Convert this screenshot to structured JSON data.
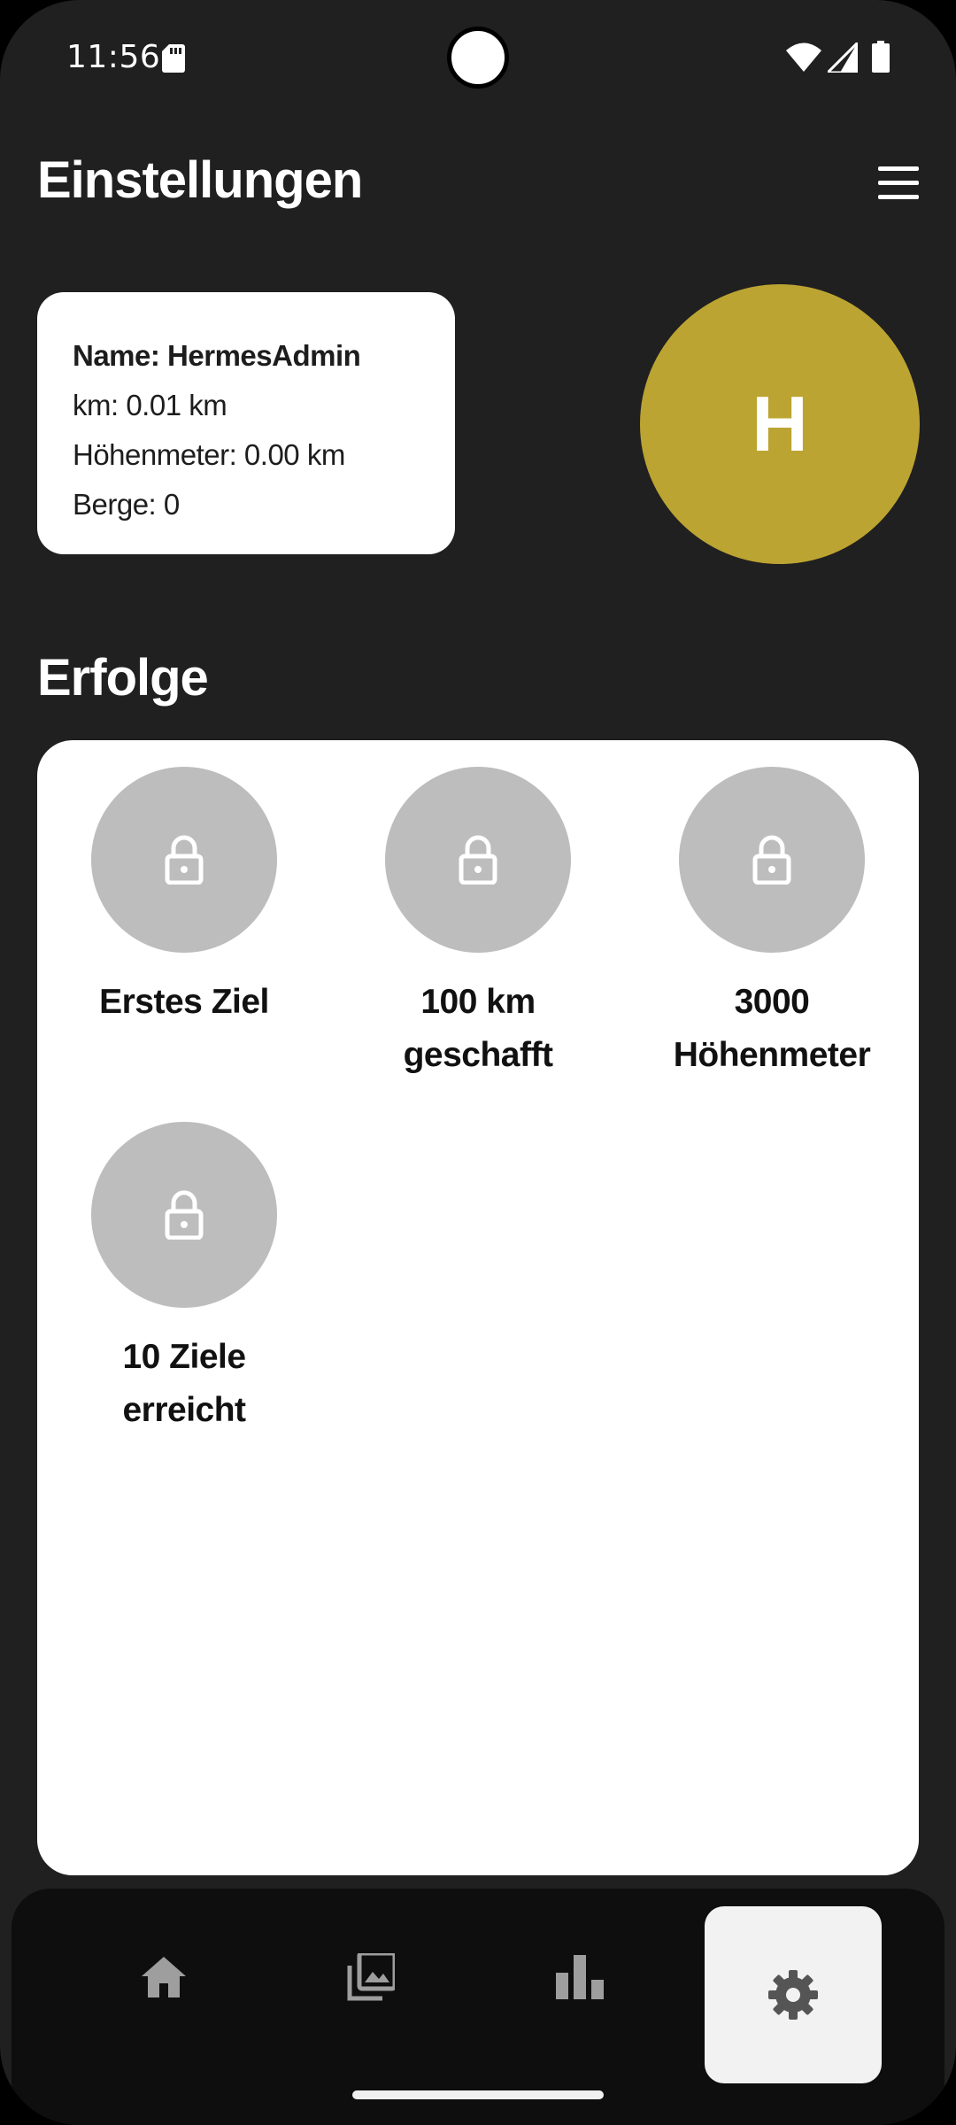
{
  "status_bar": {
    "time": "11:56",
    "icons": [
      "sd-card-icon",
      "wifi-icon",
      "signal-icon",
      "battery-icon"
    ]
  },
  "header": {
    "title": "Einstellungen",
    "menu_icon": "menu-icon"
  },
  "profile": {
    "name_line": "Name: HermesAdmin",
    "km_line": "km: 0.01 km",
    "elevation_line": "Höhenmeter: 0.00 km",
    "mountains_line": "Berge: 0",
    "avatar_initial": "H",
    "avatar_color": "#bca432"
  },
  "achievements": {
    "title": "Erfolge",
    "items": [
      {
        "line1": "Erstes Ziel",
        "line2": "",
        "locked": true,
        "icon": "lock-icon"
      },
      {
        "line1": "100 km",
        "line2": "geschafft",
        "locked": true,
        "icon": "lock-icon"
      },
      {
        "line1": "3000",
        "line2": "Höhenmeter",
        "locked": true,
        "icon": "lock-icon"
      },
      {
        "line1": "10 Ziele",
        "line2": "erreicht",
        "locked": true,
        "icon": "lock-icon"
      }
    ]
  },
  "bottom_nav": {
    "items": [
      {
        "icon": "home-icon",
        "active": false
      },
      {
        "icon": "gallery-icon",
        "active": false
      },
      {
        "icon": "bar-chart-icon",
        "active": false
      },
      {
        "icon": "gear-icon",
        "active": true
      }
    ]
  },
  "colors": {
    "background": "#202020",
    "card": "#ffffff",
    "badge_locked": "#bdbdbd",
    "nav_background": "#0e0e0e",
    "nav_active": "#f2f2f2"
  }
}
